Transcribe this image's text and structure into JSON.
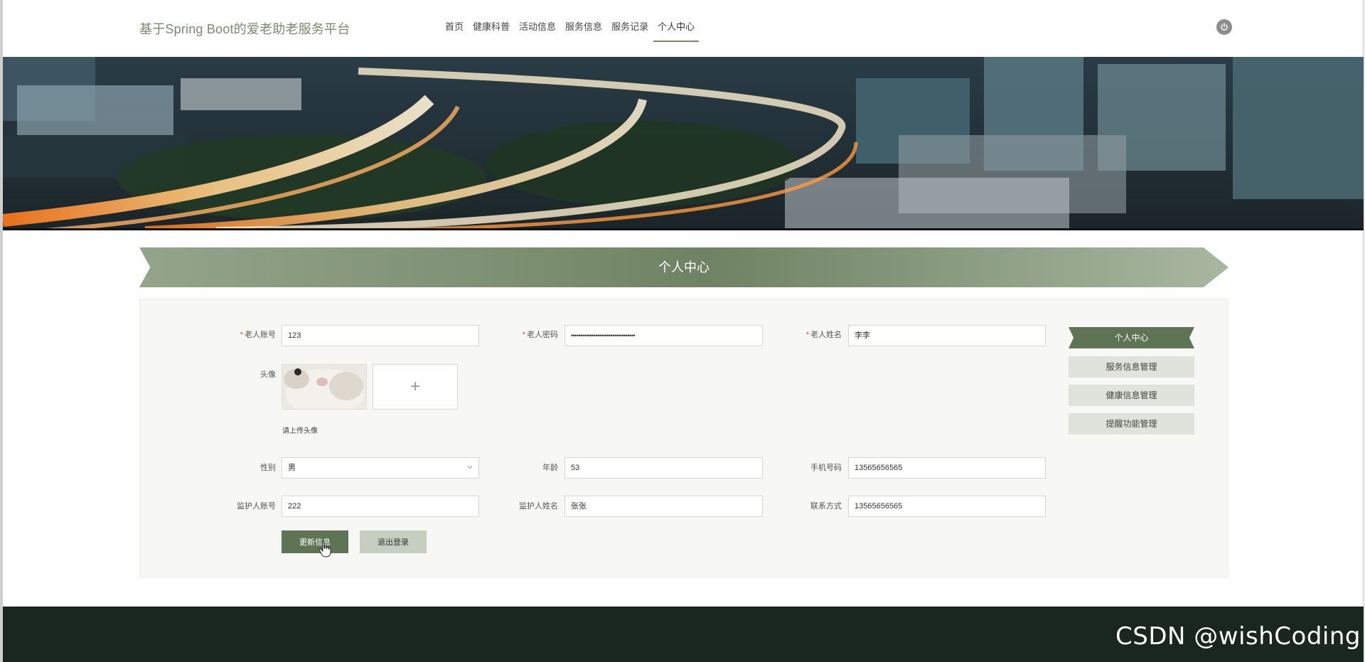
{
  "header": {
    "brand": "基于Spring Boot的爱老助老服务平台",
    "nav": [
      "首页",
      "健康科普",
      "活动信息",
      "服务信息",
      "服务记录",
      "个人中心"
    ],
    "active_nav": "个人中心"
  },
  "ribbon": {
    "title": "个人中心"
  },
  "form": {
    "account_label": "老人账号",
    "account_value": "123",
    "password_label": "老人密码",
    "password_value": "••••••••••••••••••••••••••••••••••",
    "name_label": "老人姓名",
    "name_value": "李李",
    "avatar_label": "头像",
    "upload_plus": "+",
    "upload_tip": "请上传头像",
    "gender_label": "性别",
    "gender_value": "男",
    "age_label": "年龄",
    "age_value": "53",
    "phone_label": "手机号码",
    "phone_value": "13565656565",
    "guardian_account_label": "监护人账号",
    "guardian_account_value": "222",
    "guardian_name_label": "监护人姓名",
    "guardian_name_value": "张张",
    "contact_label": "联系方式",
    "contact_value": "13565656565",
    "update_button": "更新信息",
    "logout_button": "退出登录"
  },
  "side_menu": {
    "items": [
      "个人中心",
      "服务信息管理",
      "健康信息管理",
      "提醒功能管理"
    ],
    "active": "个人中心"
  },
  "footer": {
    "watermark": "CSDN @wishCoding"
  },
  "colors": {
    "accent": "#5f7355",
    "brand_text": "#7b8a6e",
    "footer_bg": "#1a2620",
    "required": "#e0493b"
  }
}
